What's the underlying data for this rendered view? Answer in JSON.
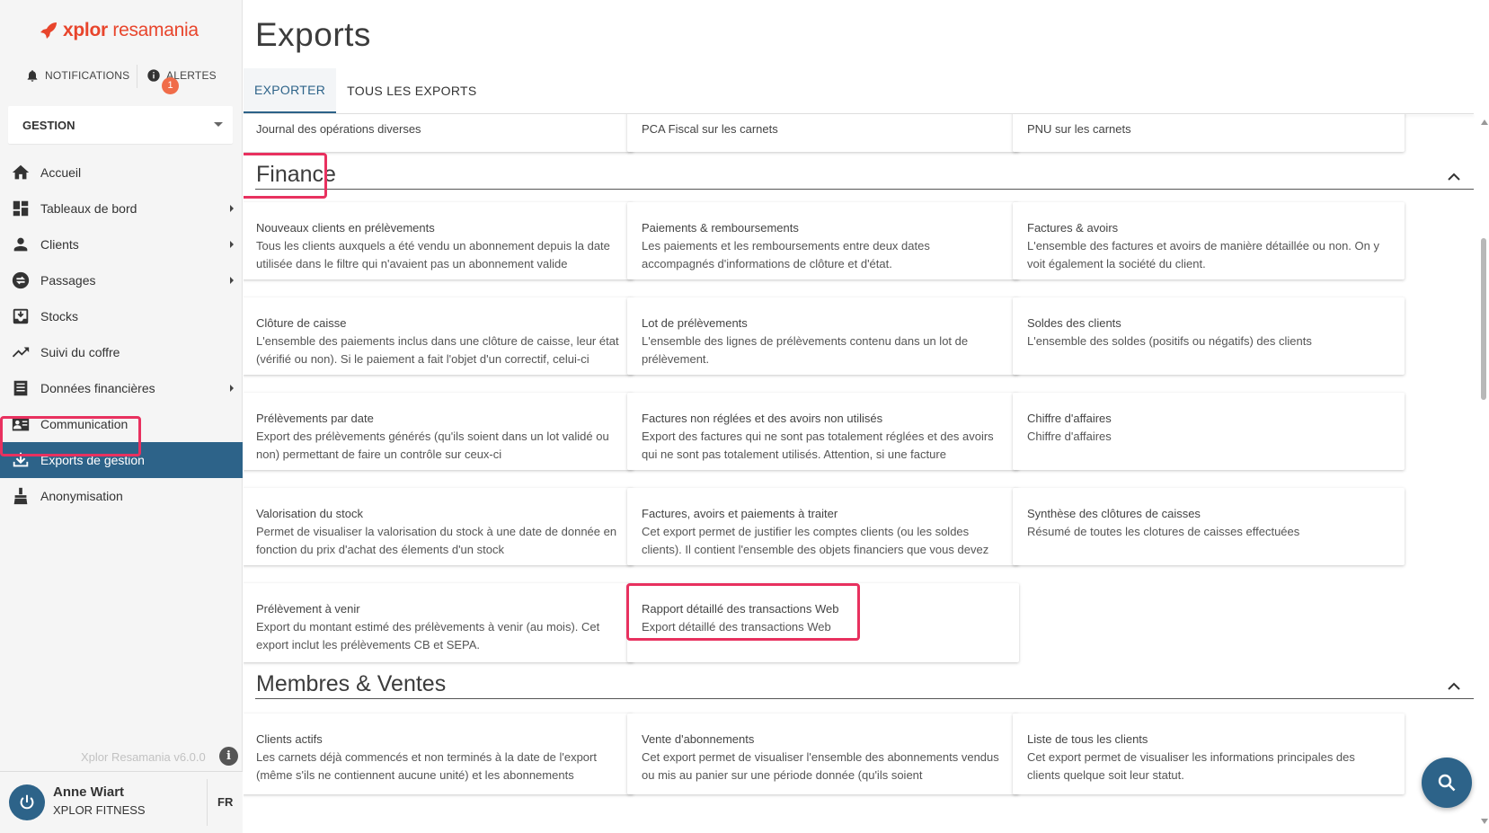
{
  "brand": {
    "name_bold": "xplor",
    "name_rest": " resamania"
  },
  "topbar": {
    "notifications_label": "NOTIFICATIONS",
    "alerts_label": "ALERTES",
    "alerts_count": "1"
  },
  "context_select": {
    "value": "GESTION"
  },
  "nav": {
    "items": [
      {
        "label": "Accueil",
        "icon": "home-icon",
        "has_submenu": false
      },
      {
        "label": "Tableaux de bord",
        "icon": "dashboard-icon",
        "has_submenu": true
      },
      {
        "label": "Clients",
        "icon": "person-icon",
        "has_submenu": true
      },
      {
        "label": "Passages",
        "icon": "swap-icon",
        "has_submenu": true
      },
      {
        "label": "Stocks",
        "icon": "inbox-icon",
        "has_submenu": false
      },
      {
        "label": "Suivi du coffre",
        "icon": "trending-icon",
        "has_submenu": false
      },
      {
        "label": "Données financières",
        "icon": "list-icon",
        "has_submenu": true
      },
      {
        "label": "Communication",
        "icon": "contact-card-icon",
        "has_submenu": false
      },
      {
        "label": "Exports de gestion",
        "icon": "download-icon",
        "has_submenu": false,
        "active": true
      },
      {
        "label": "Anonymisation",
        "icon": "broom-icon",
        "has_submenu": false
      }
    ]
  },
  "footer": {
    "version": "Xplor Resamania v6.0.0",
    "user_name": "Anne Wiart",
    "club": "XPLOR FITNESS",
    "lang": "FR"
  },
  "page": {
    "title": "Exports"
  },
  "tabs": [
    {
      "label": "EXPORTER",
      "active": true
    },
    {
      "label": "TOUS LES EXPORTS",
      "active": false
    }
  ],
  "prev_row": [
    {
      "title": "Journal des opérations diverses"
    },
    {
      "title": "PCA Fiscal sur les carnets"
    },
    {
      "title": "PNU sur les carnets"
    }
  ],
  "finance": {
    "title": "Finance",
    "cards": [
      {
        "title": "Nouveaux clients en prélèvements",
        "desc": "Tous les clients auxquels a été vendu un abonnement depuis la date utilisée dans le filtre qui n'avaient pas un abonnement valide"
      },
      {
        "title": "Paiements & remboursements",
        "desc": "Les paiements et les remboursements entre deux dates accompagnés d'informations de clôture et d'état."
      },
      {
        "title": "Factures & avoirs",
        "desc": "L'ensemble des factures et avoirs de manière détaillée ou non. On y voit également la société du client."
      },
      {
        "title": "Clôture de caisse",
        "desc": "L'ensemble des paiements inclus dans une clôture de caisse, leur état (vérifié ou non). Si le paiement a fait l'objet d'un correctif, celui-ci"
      },
      {
        "title": "Lot de prélèvements",
        "desc": "L'ensemble des lignes de prélèvements contenu dans un lot de prélèvement."
      },
      {
        "title": "Soldes des clients",
        "desc": "L'ensemble des soldes (positifs ou négatifs) des clients"
      },
      {
        "title": "Prélèvements par date",
        "desc": "Export des prélèvements générés (qu'ils soient dans un lot validé ou non) permettant de faire un contrôle sur ceux-ci"
      },
      {
        "title": "Factures non réglées et des avoirs non utilisés",
        "desc": "Export des factures qui ne sont pas totalement réglées et des avoirs qui ne sont pas totalement utilisés. Attention, si une facture"
      },
      {
        "title": "Chiffre d'affaires",
        "desc": "Chiffre d'affaires"
      },
      {
        "title": "Valorisation du stock",
        "desc": "Permet de visualiser la valorisation du stock à une date de donnée en fonction du prix d'achat des élements d'un stock"
      },
      {
        "title": "Factures, avoirs et paiements à traiter",
        "desc": "Cet export permet de justifier les comptes clients (ou les soldes clients). Il contient l'ensemble des objets financiers que vous devez"
      },
      {
        "title": "Synthèse des clôtures de caisses",
        "desc": "Résumé de toutes les clotures de caisses effectuées"
      },
      {
        "title": "Prélèvement à venir",
        "desc": "Export du montant estimé des prélèvements à venir (au mois). Cet export inclut les prélèvements CB et SEPA."
      },
      {
        "title": "Rapport détaillé des transactions Web",
        "desc": "Export détaillé des transactions Web"
      }
    ]
  },
  "members": {
    "title": "Membres & Ventes",
    "cards": [
      {
        "title": "Clients actifs",
        "desc": "Les carnets déjà commencés et non terminés à la date de l'export (même s'ils ne contiennent aucune unité) et les abonnements"
      },
      {
        "title": "Vente d'abonnements",
        "desc": "Cet export permet de visualiser l'ensemble des abonnements vendus ou mis au panier sur une période donnée (qu'ils soient"
      },
      {
        "title": "Liste de tous les clients",
        "desc": "Cet export permet de visualiser les informations principales des clients quelque soit leur statut."
      }
    ]
  },
  "colors": {
    "primary": "#2d6389",
    "brand": "#e8452c",
    "highlight": "#e8315f",
    "badge": "#f06c49"
  }
}
